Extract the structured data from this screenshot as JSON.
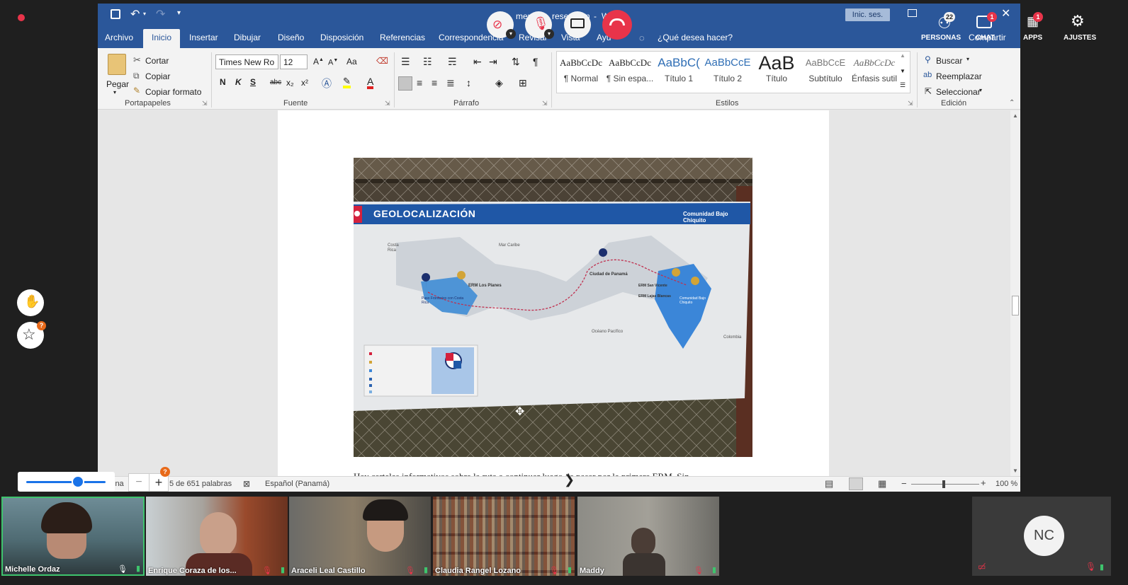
{
  "word": {
    "title_fragments": [
      "mentar",
      "resent",
      "n",
      "-",
      "W"
    ],
    "signin_button": "Inic. ses.",
    "tabs": [
      "Archivo",
      "Inicio",
      "Insertar",
      "Dibujar",
      "Diseño",
      "Disposición",
      "Referencias",
      "Correspondencia",
      "Revisar",
      "Vista",
      "Ayu"
    ],
    "tell_me": "¿Qué desea hacer?",
    "share_label": "Compartir",
    "clipboard": {
      "paste": "Pegar",
      "cut": "Cortar",
      "copy": "Copiar",
      "format_painter": "Copiar formato",
      "group": "Portapapeles"
    },
    "font": {
      "name": "Times New Ro",
      "size": "12",
      "case": "Aa",
      "bold": "N",
      "italic": "K",
      "underline": "S",
      "strike": "abc",
      "sub": "x₂",
      "sup": "x²",
      "group": "Fuente"
    },
    "paragraph": {
      "group": "Párrafo"
    },
    "styles": {
      "group": "Estilos",
      "items": [
        {
          "preview": "AaBbCcDc",
          "name": "¶ Normal"
        },
        {
          "preview": "AaBbCcDc",
          "name": "¶ Sin espa..."
        },
        {
          "preview": "AaBbC(",
          "name": "Título 1"
        },
        {
          "preview": "AaBbCcE",
          "name": "Título 2"
        },
        {
          "preview": "AaB",
          "name": "Título"
        },
        {
          "preview": "AaBbCcE",
          "name": "Subtítulo"
        },
        {
          "preview": "AaBbCcDc",
          "name": "Énfasis sutil"
        }
      ]
    },
    "editing": {
      "find": "Buscar",
      "replace": "Reemplazar",
      "select": "Seleccionar",
      "group": "Edición"
    },
    "map": {
      "title": "GEOLOCALIZACIÓN",
      "community": "Comunidad Bajo Chiquito",
      "labels": {
        "costa_rica": "Costa Rica",
        "mar_caribe": "Mar Caribe",
        "ciudad_panama": "Ciudad de Panamá",
        "erm_los_planes": "ERM Los Planes",
        "paso_canoas": "Paso Fronterizo con Costa Rica",
        "erm_san_vicente": "ERM San Vicente",
        "erm_lajas_blancas": "ERM Lajas Blancas",
        "comunidad": "Comunidad Bajo Chiquito",
        "oceano": "Océano Pacífico",
        "colombia": "Colombia"
      }
    },
    "doc_text": "Hay carteles informativos sobre la ruta a continuar luego de pasar por la primera ERM. Sin",
    "status": {
      "page": "ina",
      "words": "5 de 651 palabras",
      "language": "Español (Panamá)",
      "zoom": "100 %"
    }
  },
  "meeting": {
    "toolbar": {
      "people_label": "PERSONAS",
      "people_count": "22",
      "chat_label": "CHAT",
      "chat_count": "1",
      "apps_label": "APPS",
      "apps_count": "1",
      "settings_label": "AJUSTES"
    },
    "zoom_badge": "?",
    "star_badge": "?",
    "participants": [
      {
        "name": "Michelle Ordaz"
      },
      {
        "name": "Enrique Coraza de los..."
      },
      {
        "name": "Araceli Leal Castillo"
      },
      {
        "name": "Claudia Rangel Lozano"
      },
      {
        "name": "Maddy"
      }
    ],
    "self_initials": "NC"
  },
  "colors": {
    "word_blue": "#2b579a",
    "hangup": "#e8344a",
    "accent": "#1a73e8",
    "active_speaker": "#3ec46d"
  }
}
